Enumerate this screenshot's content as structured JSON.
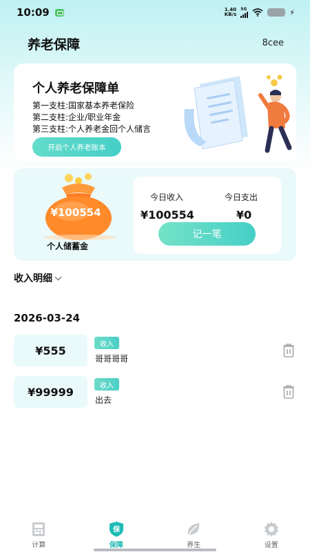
{
  "status_bar": {
    "time": "10:09",
    "net_speed_value": "1.40",
    "net_speed_unit": "KB/s",
    "network": "5G"
  },
  "header": {
    "title": "养老保障",
    "right_text": "8cee"
  },
  "banner": {
    "title": "个人养老保障单",
    "lines": [
      "第一支柱:国家基本养老保险",
      "第二支柱:企业/职业年金",
      "第三支柱:个人养老金回个人储言"
    ],
    "button_label": "开启个人养老账本"
  },
  "savings": {
    "amount": "¥100554",
    "label": "个人储蓄金",
    "income_label": "今日收入",
    "income_value": "¥100554",
    "expense_label": "今日支出",
    "expense_value": "¥0",
    "record_button": "记一笔"
  },
  "details": {
    "title": "收入明细",
    "date": "2026-03-24",
    "entries": [
      {
        "amount": "¥555",
        "tag": "收入",
        "note": "哥哥哥哥"
      },
      {
        "amount": "¥99999",
        "tag": "收入",
        "note": "出去"
      }
    ]
  },
  "tabbar": {
    "items": [
      {
        "label": "计算",
        "icon": "calculator-icon"
      },
      {
        "label": "保障",
        "icon": "shield-icon",
        "active": true
      },
      {
        "label": "养生",
        "icon": "leaf-icon"
      },
      {
        "label": "设置",
        "icon": "gear-icon"
      }
    ]
  },
  "colors": {
    "accent": "#45cfc7",
    "header_bg": "#bff1f3",
    "card_bg": "#eaf9f9"
  }
}
